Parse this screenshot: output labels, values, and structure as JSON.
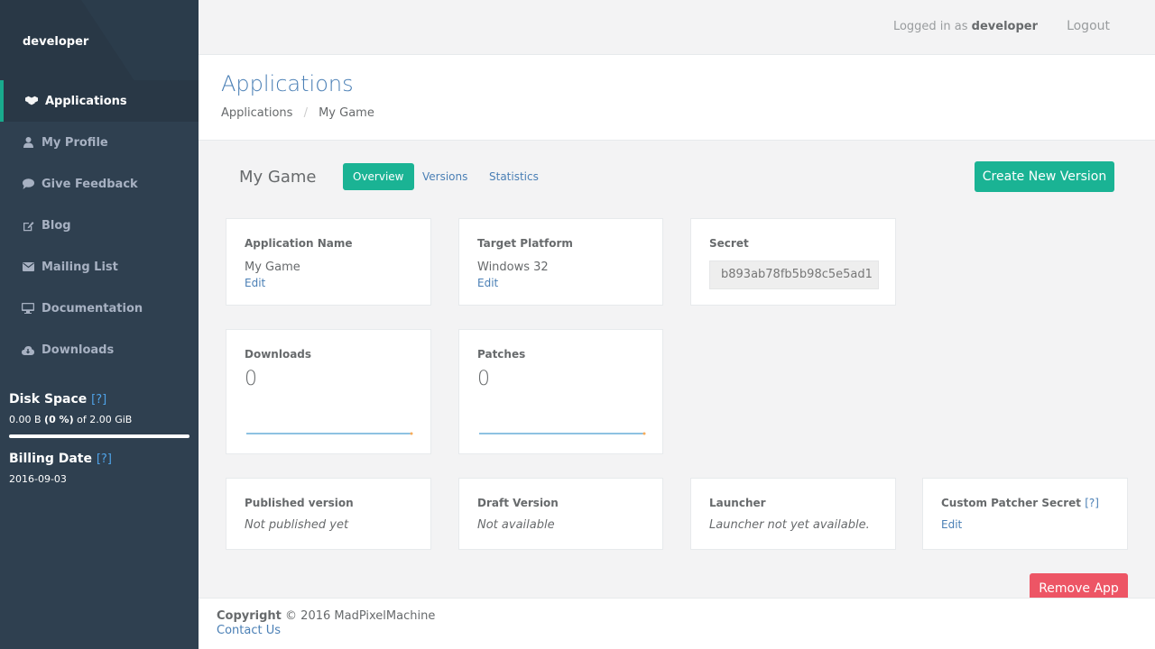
{
  "sidebar": {
    "username": "developer",
    "items": [
      {
        "label": "Applications",
        "icon": "cubes-icon"
      },
      {
        "label": "My Profile",
        "icon": "user-icon"
      },
      {
        "label": "Give Feedback",
        "icon": "comment-icon"
      },
      {
        "label": "Blog",
        "icon": "edit-icon"
      },
      {
        "label": "Mailing List",
        "icon": "envelope-icon"
      },
      {
        "label": "Documentation",
        "icon": "desktop-icon"
      },
      {
        "label": "Downloads",
        "icon": "cloud-download-icon"
      }
    ],
    "disk_space": {
      "title": "Disk Space",
      "help": "[?]",
      "used": "0.00 B",
      "percent": "(0 %)",
      "of_text": "of 2.00 GiB",
      "usage_fraction": 0
    },
    "billing": {
      "title": "Billing Date",
      "help": "[?]",
      "date": "2016-09-03"
    }
  },
  "topbar": {
    "logged_in_prefix": "Logged in as",
    "logged_in_user": "developer",
    "logout_label": "Logout"
  },
  "heading": {
    "title": "Applications",
    "breadcrumb": [
      "Applications",
      "My Game"
    ],
    "breadcrumb_sep": "/"
  },
  "main": {
    "app_name": "My Game",
    "tabs": [
      "Overview",
      "Versions",
      "Statistics"
    ],
    "create_button": "Create New Version",
    "remove_button": "Remove App",
    "cards": {
      "app_name": {
        "label": "Application Name",
        "value": "My Game",
        "link": "Edit"
      },
      "platform": {
        "label": "Target Platform",
        "value": "Windows 32",
        "link": "Edit"
      },
      "secret": {
        "label": "Secret",
        "value": "b893ab78fb5b98c5e5ad1"
      },
      "downloads": {
        "label": "Downloads",
        "value": "0"
      },
      "patches": {
        "label": "Patches",
        "value": "0"
      },
      "published": {
        "label": "Published version",
        "value": "Not published yet"
      },
      "draft": {
        "label": "Draft Version",
        "value": "Not available"
      },
      "launcher": {
        "label": "Launcher",
        "value": "Launcher not yet available."
      },
      "custom_patcher": {
        "label": "Custom Patcher Secret",
        "help": "[?]",
        "link": "Edit"
      }
    }
  },
  "footer": {
    "copyright_label": "Copyright",
    "copyright_text": "© 2016 MadPixelMachine",
    "contact": "Contact Us"
  },
  "colors": {
    "sidebar_bg": "#2f4050",
    "accent": "#1ab394",
    "danger": "#ed5565",
    "link": "#4a7fb5",
    "sparkline_line": "#1c84c6",
    "sparkline_dot": "#f8ac59"
  }
}
